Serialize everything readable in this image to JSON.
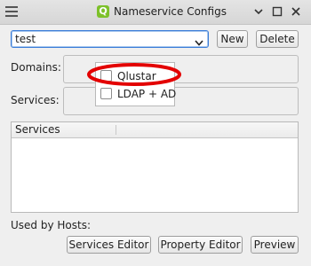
{
  "window": {
    "title": "Nameservice Configs",
    "app_icon_glyph": "Q"
  },
  "config_select": {
    "value": "test"
  },
  "buttons": {
    "new": "New",
    "delete": "Delete",
    "services_editor": "Services Editor",
    "property_editor": "Property Editor",
    "preview": "Preview"
  },
  "labels": {
    "domains": "Domains:",
    "services": "Services:",
    "used_by_hosts": "Used by Hosts:"
  },
  "domains_popup": {
    "items": [
      {
        "label": "Qlustar",
        "checked": false
      },
      {
        "label": "LDAP + AD",
        "checked": false
      }
    ]
  },
  "services_table": {
    "columns": [
      "Services",
      ""
    ]
  },
  "colors": {
    "highlight": "#e30000",
    "focus": "#3b7dd8",
    "app_icon": "#7dc12a"
  }
}
